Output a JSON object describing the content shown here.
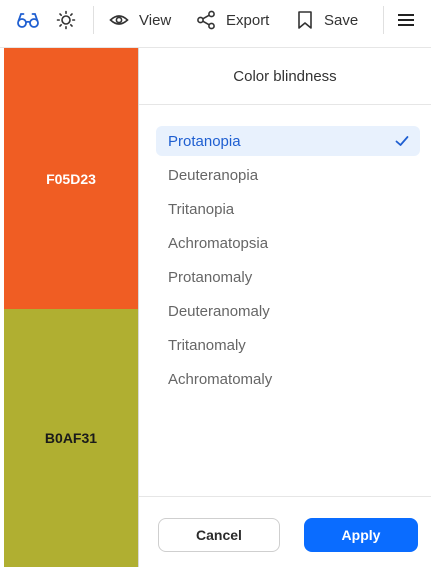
{
  "toolbar": {
    "view_label": "View",
    "export_label": "Export",
    "save_label": "Save"
  },
  "swatches": [
    {
      "label": "F05D23",
      "color": "#F05D23"
    },
    {
      "label": "B0AF31",
      "color": "#B0AF31"
    }
  ],
  "panel": {
    "title": "Color blindness",
    "options": [
      {
        "label": "Protanopia",
        "selected": true
      },
      {
        "label": "Deuteranopia",
        "selected": false
      },
      {
        "label": "Tritanopia",
        "selected": false
      },
      {
        "label": "Achromatopsia",
        "selected": false
      },
      {
        "label": "Protanomaly",
        "selected": false
      },
      {
        "label": "Deuteranomaly",
        "selected": false
      },
      {
        "label": "Tritanomaly",
        "selected": false
      },
      {
        "label": "Achromatomaly",
        "selected": false
      }
    ],
    "cancel_label": "Cancel",
    "apply_label": "Apply"
  },
  "colors": {
    "accent": "#0A6CFF",
    "selected_bg": "#E8F1FD",
    "selected_text": "#1F5FD1"
  },
  "icons": {
    "color_blind": "glasses-icon",
    "brightness": "sun-icon",
    "view": "eye-icon",
    "export": "share-icon",
    "save": "bookmark-icon",
    "menu": "hamburger-menu-icon",
    "check": "check-icon"
  }
}
